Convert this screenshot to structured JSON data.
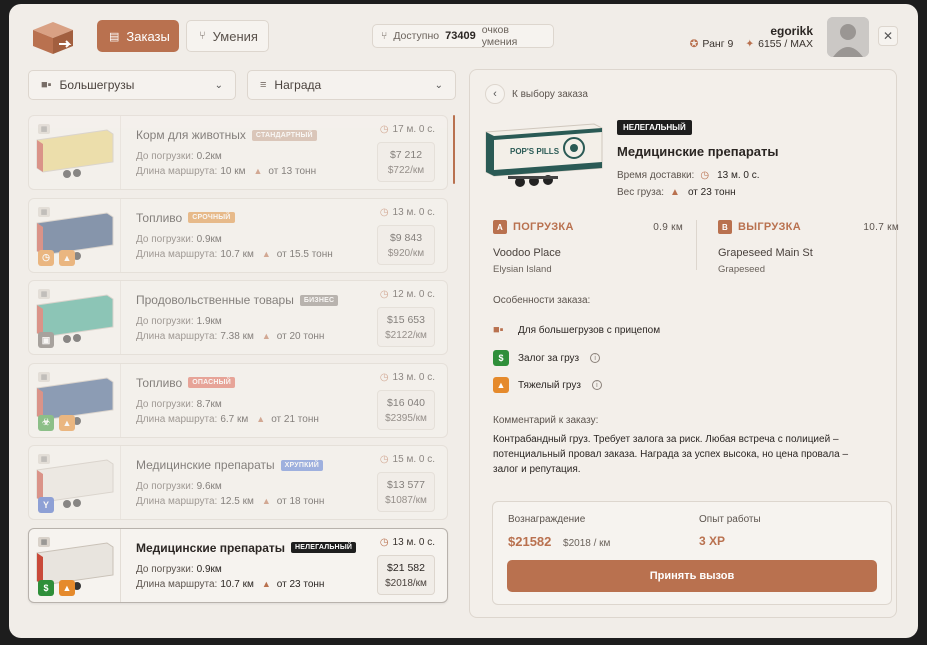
{
  "header": {
    "tabs": [
      {
        "label": "Заказы",
        "active": true
      },
      {
        "label": "Умения",
        "active": false
      }
    ],
    "points": {
      "prefix": "Доступно",
      "value": "73409",
      "suffix": "очков умения"
    },
    "user": {
      "name": "egorikk",
      "rank": "Ранг 9",
      "xp": "6155 / MAX"
    },
    "close_icon": "close-icon"
  },
  "filters": {
    "vehicle": "Большегрузы",
    "sort": "Награда"
  },
  "orders": [
    {
      "name": "Корм для животных",
      "tag": "Стандартный",
      "tag_color": "#c9a894",
      "load_label": "До погрузки:",
      "load": "0.2км",
      "route_label": "Длина маршрута:",
      "route": "10 км",
      "weight": "от 13 тонн",
      "time": "17 м. 0 с.",
      "price": "$7 212",
      "per_km": "$722/км",
      "badges": []
    },
    {
      "name": "Топливо",
      "tag": "Срочный",
      "tag_color": "#e0913e",
      "load_label": "До погрузки:",
      "load": "0.9км",
      "route_label": "Длина маршрута:",
      "route": "10.7 км",
      "weight": "от 15.5 тонн",
      "time": "13 м. 0 с.",
      "price": "$9 843",
      "per_km": "$920/км",
      "badges": [
        {
          "icon": "clock-icon",
          "color": "#e58a2c",
          "glyph": "◷"
        },
        {
          "icon": "weight-icon",
          "color": "#e58a2c",
          "glyph": "▲"
        }
      ]
    },
    {
      "name": "Продовольственные товары",
      "tag": "Бизнес",
      "tag_color": "#8a8480",
      "load_label": "До погрузки:",
      "load": "1.9км",
      "route_label": "Длина маршрута:",
      "route": "7.38 км",
      "weight": "от 20 тонн",
      "time": "12 м. 0 с.",
      "price": "$15 653",
      "per_km": "$2122/км",
      "badges": [
        {
          "icon": "briefcase-icon",
          "color": "#6b6560",
          "glyph": "▣"
        }
      ]
    },
    {
      "name": "Топливо",
      "tag": "Опасный",
      "tag_color": "#e06a58",
      "load_label": "До погрузки:",
      "load": "8.7км",
      "route_label": "Длина маршрута:",
      "route": "6.7 км",
      "weight": "от 21 тонн",
      "time": "13 м. 0 с.",
      "price": "$16 040",
      "per_km": "$2395/км",
      "badges": [
        {
          "icon": "biohazard-icon",
          "color": "#3a9a3a",
          "glyph": "☣"
        },
        {
          "icon": "weight-icon",
          "color": "#e58a2c",
          "glyph": "▲"
        }
      ]
    },
    {
      "name": "Медицинские препараты",
      "tag": "Хрупкий",
      "tag_color": "#5b7fd6",
      "load_label": "До погрузки:",
      "load": "9.6км",
      "route_label": "Длина маршрута:",
      "route": "12.5 км",
      "weight": "от 18 тонн",
      "time": "15 м. 0 с.",
      "price": "$13 577",
      "per_km": "$1087/км",
      "badges": [
        {
          "icon": "glass-icon",
          "color": "#3f62c6",
          "glyph": "Y"
        }
      ]
    },
    {
      "name": "Медицинские препараты",
      "tag": "Нелегальный",
      "tag_color": "#1e1e1e",
      "load_label": "До погрузки:",
      "load": "0.9км",
      "route_label": "Длина маршрута:",
      "route": "10.7 км",
      "weight": "от 23 тонн",
      "time": "13 м. 0 с.",
      "price": "$21 582",
      "per_km": "$2018/км",
      "badges": [
        {
          "icon": "dollar-icon",
          "color": "#2f8f3a",
          "glyph": "$"
        },
        {
          "icon": "weight-icon",
          "color": "#e58a2c",
          "glyph": "▲"
        }
      ]
    }
  ],
  "detail": {
    "back_label": "К выбору заказа",
    "tag": "Нелегальный",
    "title": "Медицинские препараты",
    "delivery_label": "Время доставки:",
    "delivery_time": "13 м. 0 с.",
    "weight_label": "Вес груза:",
    "weight": "от 23 тонн",
    "pickup": {
      "letter": "A",
      "title": "ПОГРУЗКА",
      "km": "0.9 км",
      "address": "Voodoo Place",
      "area": "Elysian Island"
    },
    "dropoff": {
      "letter": "B",
      "title": "ВЫГРУЗКА",
      "km": "10.7 км",
      "address": "Grapeseed Main St",
      "area": "Grapeseed"
    },
    "features_label": "Особенности заказа:",
    "features": [
      {
        "label": "Для большегрузов с прицепом",
        "icon": "truck-icon",
        "color": "#b9714f",
        "info": false
      },
      {
        "label": "Залог за груз",
        "icon": "dollar-icon",
        "color": "#2f8f3a",
        "info": true
      },
      {
        "label": "Тяжелый груз",
        "icon": "weight-icon",
        "color": "#e58a2c",
        "info": true
      }
    ],
    "comment_label": "Комментарий к заказу:",
    "comment": "Контрабандный груз. Требует залога за риск. Любая встреча с полицией – потенциальный провал заказа. Награда за успех высока, но цена провала – залог и репутация.",
    "reward_label": "Вознаграждение",
    "reward": "$21582",
    "reward_per_km": "$2018 / км",
    "xp_label": "Опыт работы",
    "xp": "3 XP",
    "accept_label": "Принять вызов",
    "trailer_brand": "POP'S PILLS"
  },
  "colors": {
    "accent": "#b9714f",
    "bg": "#f1ede8"
  }
}
